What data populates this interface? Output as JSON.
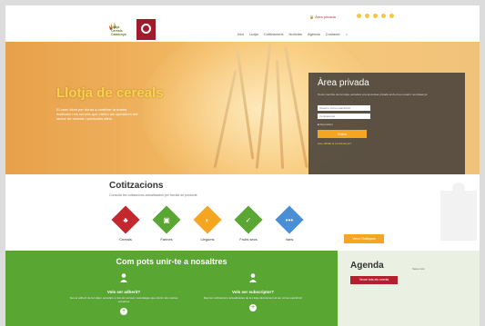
{
  "header": {
    "logo_text": [
      "Llotja",
      "Cereals",
      "Catalunya"
    ],
    "top_link": "Àrea privada",
    "nav": [
      "Inici",
      "Llotja",
      "Cotitzacions",
      "Notícies",
      "Agenda",
      "Contacte"
    ]
  },
  "hero": {
    "title": "Llotja de cereals",
    "text": "El camí idoni per donar a conèixer la nostra institució i els serveis que oferim als operadors del sector de cereals i productes afins"
  },
  "private_area": {
    "title": "Àrea privada",
    "description": "Si ets membre de la Llotja, accedeix a la teva àrea privada amb el teu usuari i contrasenya",
    "user_placeholder": "Usuari o correu electrònic",
    "password_placeholder": "Contrasenya",
    "remember_label": "Recorda'm",
    "submit_label": "Entra",
    "forgot_label": "Has oblidat la contrasenya?"
  },
  "quotations": {
    "title": "Cotitzacions",
    "subtitle": "Consulta les cotitzacions actualitzades per família de producte",
    "categories": [
      {
        "label": "Cereals",
        "color": "#c4282f",
        "icon": "wheat-icon"
      },
      {
        "label": "Farines",
        "color": "#5aa632",
        "icon": "flour-bag-icon"
      },
      {
        "label": "Llegums",
        "color": "#f4a623",
        "icon": "legume-icon"
      },
      {
        "label": "Fruits secs",
        "color": "#5aa632",
        "icon": "nut-icon"
      },
      {
        "label": "Varis",
        "color": "#4a8fd6",
        "icon": "dots-icon"
      }
    ],
    "graph_button": "Veure Gràfiques"
  },
  "join": {
    "title": "Com pots unir-te a nosaltres",
    "col1_title": "Vols ser adherit?",
    "col1_text": "Fes-te adherit de la Llotja i accedeix a tots els serveis i avantatges que oferim als nostres membres",
    "col2_title": "Vols ser subscriptor?",
    "col2_text": "Rep les cotitzacions actualitzades de la Llotja directament al teu correu electrònic",
    "plus": "+"
  },
  "agenda": {
    "title": "Agenda",
    "link": "Veure tots",
    "button": "Veure tots els events"
  },
  "colors": {
    "brand_red": "#b22030",
    "orange": "#f4a623",
    "green": "#5aa632"
  }
}
